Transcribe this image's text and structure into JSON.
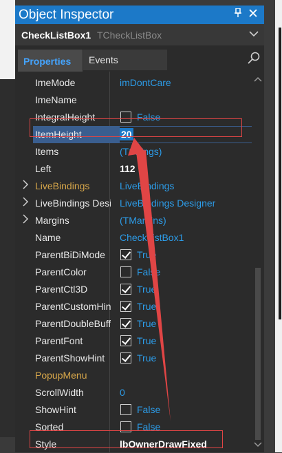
{
  "window": {
    "title": "Object Inspector",
    "pin_glyph": "🖈",
    "close_glyph": "✕"
  },
  "selector": {
    "component_name": "CheckListBox1",
    "component_type": "TCheckListBox"
  },
  "tabs": [
    {
      "label": "Properties",
      "active": true
    },
    {
      "label": "Events",
      "active": false
    }
  ],
  "properties": [
    {
      "name": "ImeMode",
      "value": "imDontCare"
    },
    {
      "name": "ImeName",
      "value": ""
    },
    {
      "name": "IntegralHeight",
      "value": "False",
      "checkbox": "unchecked"
    },
    {
      "name": "ItemHeight",
      "value": "20",
      "selected": true
    },
    {
      "name": "Items",
      "value": "(TStrings)"
    },
    {
      "name": "Left",
      "value": "112",
      "bold": true
    },
    {
      "name": "LiveBindings",
      "value": "LiveBindings",
      "expandable": true,
      "gold": true
    },
    {
      "name": "LiveBindings Designer",
      "value": "LiveBindings Designer",
      "expandable": true
    },
    {
      "name": "Margins",
      "value": "(TMargins)",
      "expandable": true
    },
    {
      "name": "Name",
      "value": "CheckListBox1"
    },
    {
      "name": "ParentBiDiMode",
      "value": "True",
      "checkbox": "checked"
    },
    {
      "name": "ParentColor",
      "value": "False",
      "checkbox": "unchecked"
    },
    {
      "name": "ParentCtl3D",
      "value": "True",
      "checkbox": "checked"
    },
    {
      "name": "ParentCustomHint",
      "value": "True",
      "checkbox": "checked"
    },
    {
      "name": "ParentDoubleBuffered",
      "value": "True",
      "checkbox": "checked"
    },
    {
      "name": "ParentFont",
      "value": "True",
      "checkbox": "checked"
    },
    {
      "name": "ParentShowHint",
      "value": "True",
      "checkbox": "checked"
    },
    {
      "name": "PopupMenu",
      "value": "",
      "gold": true
    },
    {
      "name": "ScrollWidth",
      "value": "0"
    },
    {
      "name": "ShowHint",
      "value": "False",
      "checkbox": "unchecked"
    },
    {
      "name": "Sorted",
      "value": "False",
      "checkbox": "unchecked"
    },
    {
      "name": "Style",
      "value": "lbOwnerDrawFixed",
      "bold": true
    }
  ],
  "colors": {
    "title_bar": "#1c79c8",
    "value_text": "#2c9ce8",
    "highlight_annotation": "#e04545",
    "gold_property": "#d6a64a"
  }
}
